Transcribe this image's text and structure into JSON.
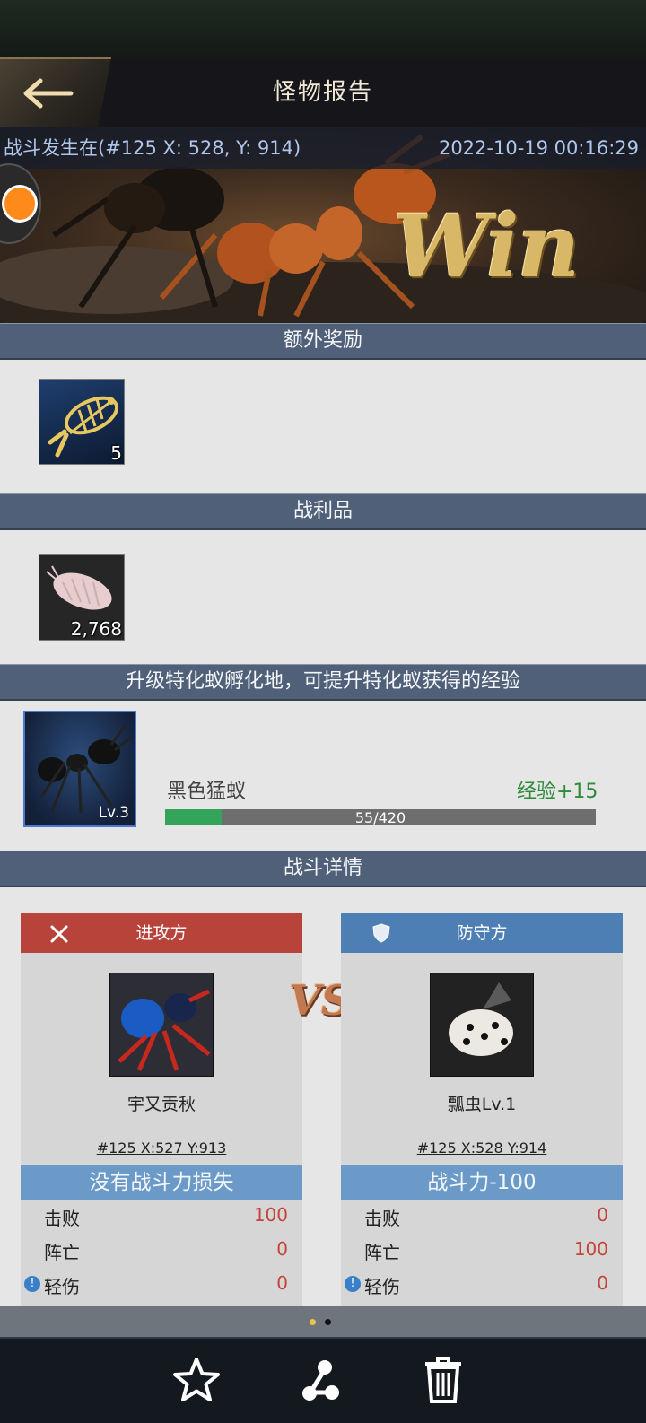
{
  "header": {
    "title": "怪物报告"
  },
  "banner": {
    "battle_location": "战斗发生在(#125 X: 528, Y: 914)",
    "timestamp": "2022-10-19 00:16:29",
    "result_text": "Win"
  },
  "sections": {
    "extra_reward": "额外奖励",
    "loot": "战利品",
    "hatchery_tip": "升级特化蚁孵化地，可提升特化蚁获得的经验",
    "battle_details": "战斗详情"
  },
  "extra_reward_item": {
    "icon": "fish-skeleton-icon",
    "count": "5"
  },
  "loot_item": {
    "icon": "woodlouse-icon",
    "count": "2,768"
  },
  "experience": {
    "ant_name": "黑色猛蚁",
    "level": "Lv.3",
    "exp_gain": "经验+15",
    "progress_text": "55/420",
    "progress_current": 55,
    "progress_max": 420
  },
  "attacker": {
    "side_label": "进攻方",
    "name": "宇又贡秋",
    "coords": "#125 X:527 Y:913",
    "power_text": "没有战斗力损失",
    "stats": [
      {
        "label": "击败",
        "value": "100"
      },
      {
        "label": "阵亡",
        "value": "0"
      },
      {
        "label": "轻伤",
        "value": "0"
      }
    ]
  },
  "defender": {
    "side_label": "防守方",
    "name": "瓢虫Lv.1",
    "coords": "#125 X:528 Y:914",
    "power_text": "战斗力-100",
    "stats": [
      {
        "label": "击败",
        "value": "0"
      },
      {
        "label": "阵亡",
        "value": "100"
      },
      {
        "label": "轻伤",
        "value": "0"
      }
    ]
  },
  "vs_text": "VS",
  "colors": {
    "section_bar": "#4f6078",
    "attacker_head": "#b8433b",
    "defender_head": "#4e7fb4",
    "power_bar": "#6c9ac8",
    "exp_fill": "#34a45a",
    "stat_value": "#c34438",
    "exp_gain": "#2e8b3a"
  },
  "bottom_icons": [
    "star-icon",
    "share-icon",
    "trash-icon"
  ]
}
